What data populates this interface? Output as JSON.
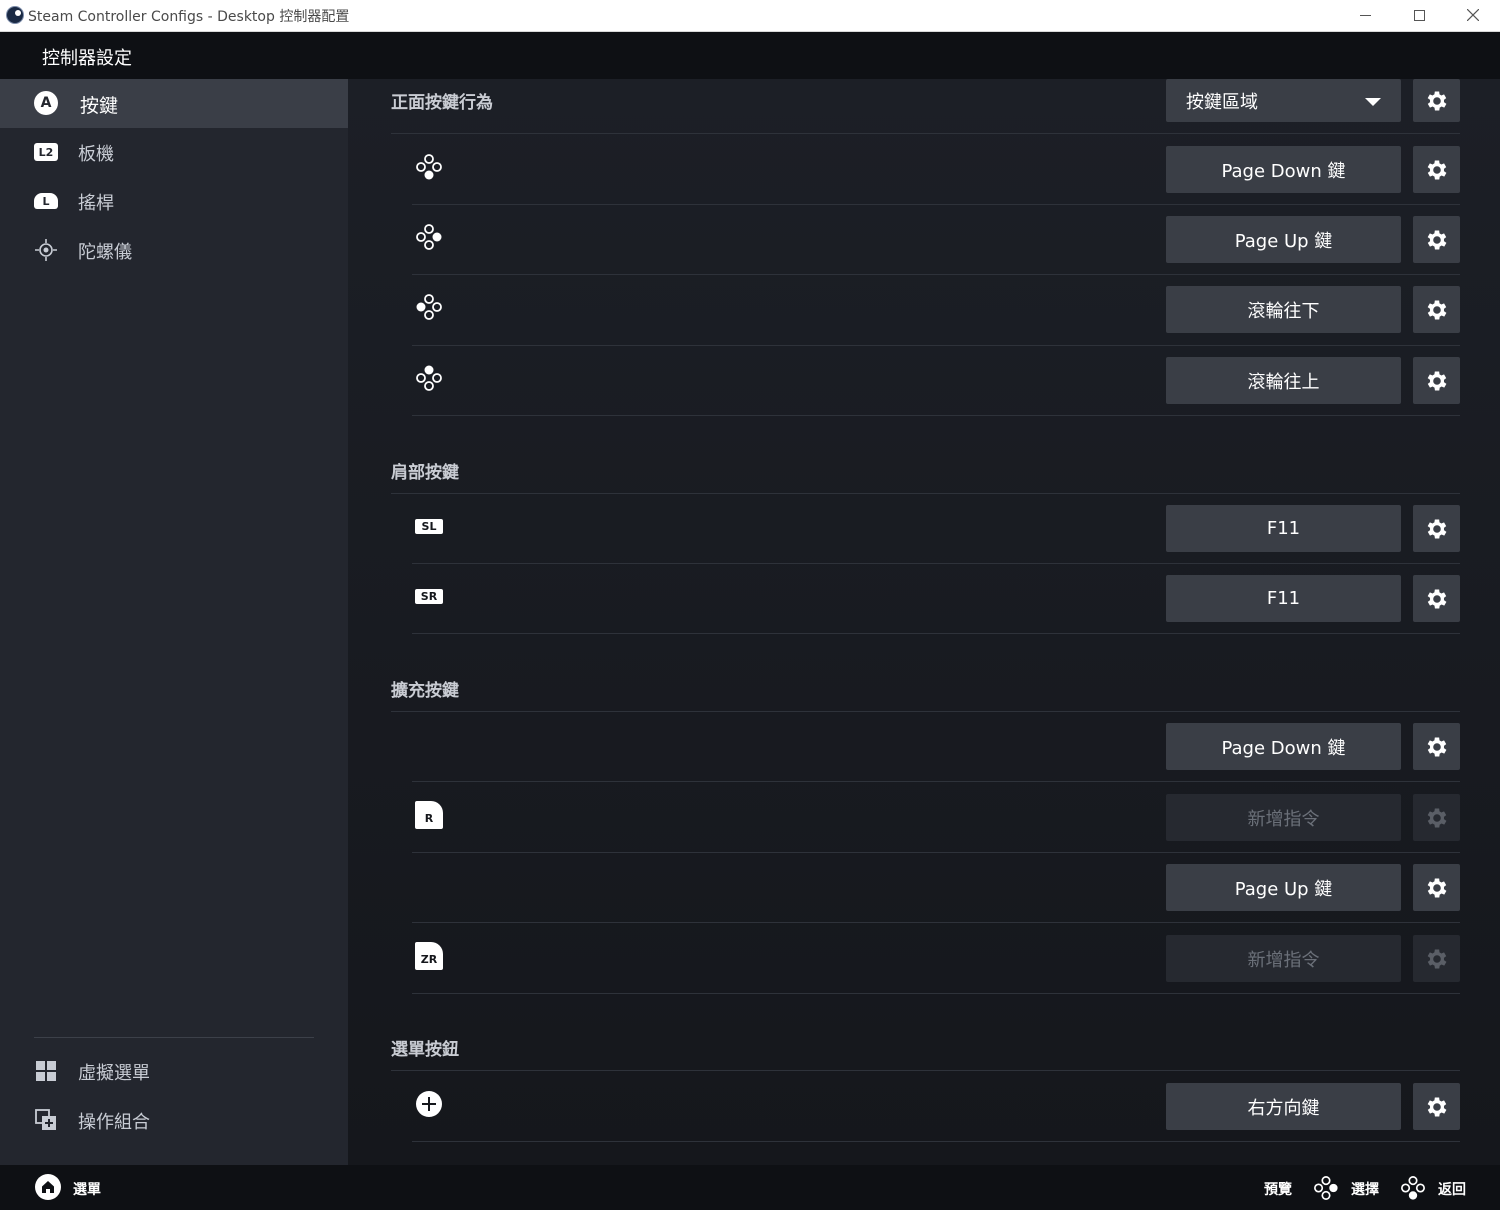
{
  "window": {
    "title": "Steam Controller Configs - Desktop 控制器配置"
  },
  "header": {
    "title": "控制器設定"
  },
  "sidebar": {
    "items": [
      {
        "label": "按鍵",
        "icon": "a-button-icon",
        "active": true
      },
      {
        "label": "板機",
        "icon": "l2-trigger-icon",
        "icon_text": "L2"
      },
      {
        "label": "搖桿",
        "icon": "l-stick-icon",
        "icon_text": "L"
      },
      {
        "label": "陀螺儀",
        "icon": "gyro-icon"
      }
    ],
    "bottom_items": [
      {
        "label": "虛擬選單",
        "icon": "grid-icon"
      },
      {
        "label": "操作組合",
        "icon": "action-set-icon"
      }
    ],
    "a_icon_text": "A"
  },
  "sections": {
    "face": {
      "title": "正面按鍵行為",
      "mode_label": "按鍵區域",
      "rows": [
        {
          "binding": "Page Down 鍵",
          "icon": "dpad-down-icon"
        },
        {
          "binding": "Page Up 鍵",
          "icon": "dpad-right-icon"
        },
        {
          "binding": "滾輪往下",
          "icon": "dpad-left-icon"
        },
        {
          "binding": "滾輪往上",
          "icon": "dpad-up-icon"
        }
      ]
    },
    "shoulder": {
      "title": "肩部按鍵",
      "rows": [
        {
          "badge": "SL",
          "binding": "F11"
        },
        {
          "badge": "SR",
          "binding": "F11"
        }
      ]
    },
    "extended": {
      "title": "擴充按鍵",
      "rows": [
        {
          "badge": "",
          "binding": "Page Down 鍵",
          "disabled": false
        },
        {
          "badge": "R",
          "binding": "新增指令",
          "disabled": true
        },
        {
          "badge": "",
          "binding": "Page Up 鍵",
          "disabled": false
        },
        {
          "badge": "ZR",
          "binding": "新增指令",
          "disabled": true
        }
      ]
    },
    "menu": {
      "title": "選單按鈕",
      "rows": [
        {
          "binding": "右方向鍵",
          "icon": "plus-button-icon"
        }
      ]
    }
  },
  "footer": {
    "menu_label": "選單",
    "preview_label": "預覽",
    "select_label": "選擇",
    "back_label": "返回"
  },
  "colors": {
    "background": "#1b1e24",
    "sidebar": "#23262e",
    "sidebar_active": "#3a3e47",
    "button": "#3a3e46",
    "button_disabled": "#262930",
    "header": "#0e1014"
  }
}
